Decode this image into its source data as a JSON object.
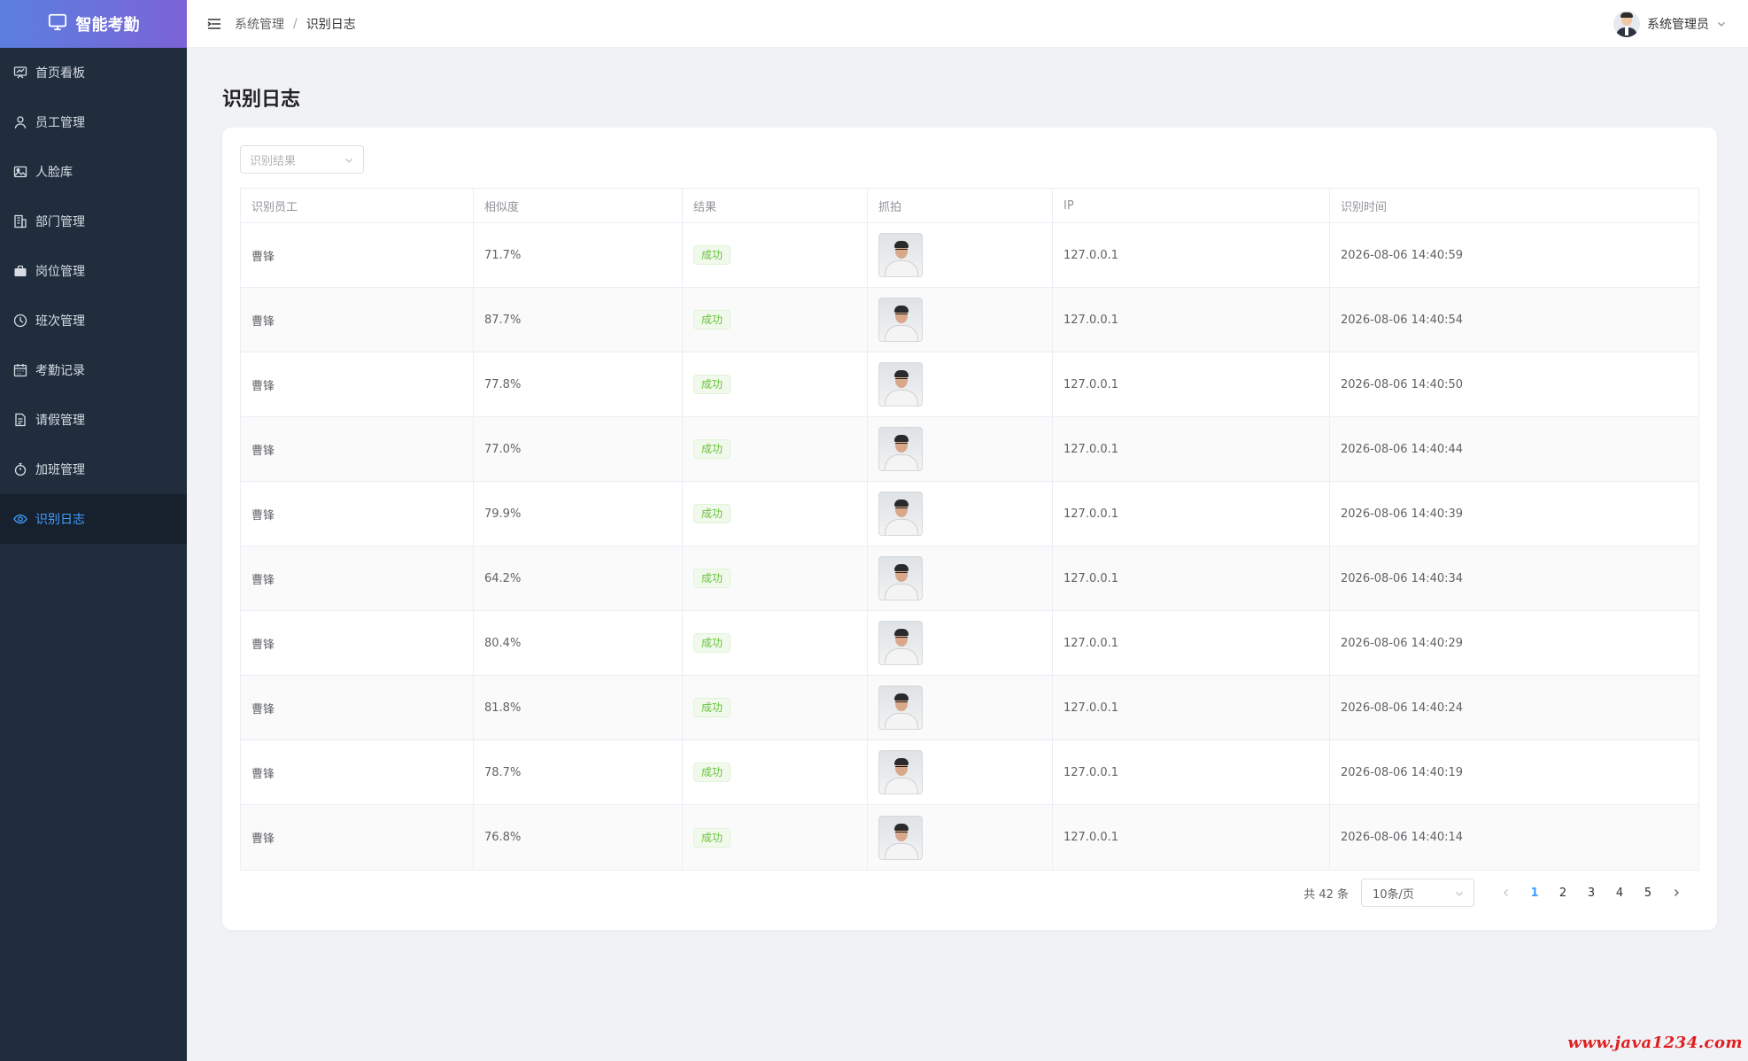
{
  "app": {
    "title": "智能考勤"
  },
  "sidebar": {
    "items": [
      {
        "label": "首页看板",
        "icon": "dashboard-icon",
        "active": false
      },
      {
        "label": "员工管理",
        "icon": "user-icon",
        "active": false
      },
      {
        "label": "人脸库",
        "icon": "picture-icon",
        "active": false
      },
      {
        "label": "部门管理",
        "icon": "building-icon",
        "active": false
      },
      {
        "label": "岗位管理",
        "icon": "briefcase-icon",
        "active": false
      },
      {
        "label": "班次管理",
        "icon": "clock-icon",
        "active": false
      },
      {
        "label": "考勤记录",
        "icon": "calendar-icon",
        "active": false
      },
      {
        "label": "请假管理",
        "icon": "document-icon",
        "active": false
      },
      {
        "label": "加班管理",
        "icon": "stopwatch-icon",
        "active": false
      },
      {
        "label": "识别日志",
        "icon": "eye-icon",
        "active": true
      }
    ]
  },
  "header": {
    "breadcrumb": [
      "系统管理",
      "识别日志"
    ],
    "breadcrumb_separator": "/",
    "user_name": "系统管理员"
  },
  "main": {
    "title": "识别日志",
    "filter": {
      "placeholder": "识别结果"
    },
    "table": {
      "columns": [
        "识别员工",
        "相似度",
        "结果",
        "抓拍",
        "IP",
        "识别时间"
      ],
      "rows": [
        {
          "employee": "曹锋",
          "similarity": "71.7%",
          "result": "成功",
          "ip": "127.0.0.1",
          "time": "2026-08-06 14:40:59"
        },
        {
          "employee": "曹锋",
          "similarity": "87.7%",
          "result": "成功",
          "ip": "127.0.0.1",
          "time": "2026-08-06 14:40:54"
        },
        {
          "employee": "曹锋",
          "similarity": "77.8%",
          "result": "成功",
          "ip": "127.0.0.1",
          "time": "2026-08-06 14:40:50"
        },
        {
          "employee": "曹锋",
          "similarity": "77.0%",
          "result": "成功",
          "ip": "127.0.0.1",
          "time": "2026-08-06 14:40:44"
        },
        {
          "employee": "曹锋",
          "similarity": "79.9%",
          "result": "成功",
          "ip": "127.0.0.1",
          "time": "2026-08-06 14:40:39"
        },
        {
          "employee": "曹锋",
          "similarity": "64.2%",
          "result": "成功",
          "ip": "127.0.0.1",
          "time": "2026-08-06 14:40:34"
        },
        {
          "employee": "曹锋",
          "similarity": "80.4%",
          "result": "成功",
          "ip": "127.0.0.1",
          "time": "2026-08-06 14:40:29"
        },
        {
          "employee": "曹锋",
          "similarity": "81.8%",
          "result": "成功",
          "ip": "127.0.0.1",
          "time": "2026-08-06 14:40:24"
        },
        {
          "employee": "曹锋",
          "similarity": "78.7%",
          "result": "成功",
          "ip": "127.0.0.1",
          "time": "2026-08-06 14:40:19"
        },
        {
          "employee": "曹锋",
          "similarity": "76.8%",
          "result": "成功",
          "ip": "127.0.0.1",
          "time": "2026-08-06 14:40:14"
        }
      ]
    },
    "pagination": {
      "total_text": "共 42 条",
      "page_size": "10条/页",
      "pages": [
        "1",
        "2",
        "3",
        "4",
        "5"
      ],
      "current": "1"
    }
  },
  "watermark": "www.java1234.com",
  "colors": {
    "accent": "#409eff",
    "sidebar_bg": "#1f2d3d",
    "success": "#67c23a",
    "watermark": "#e02020"
  }
}
